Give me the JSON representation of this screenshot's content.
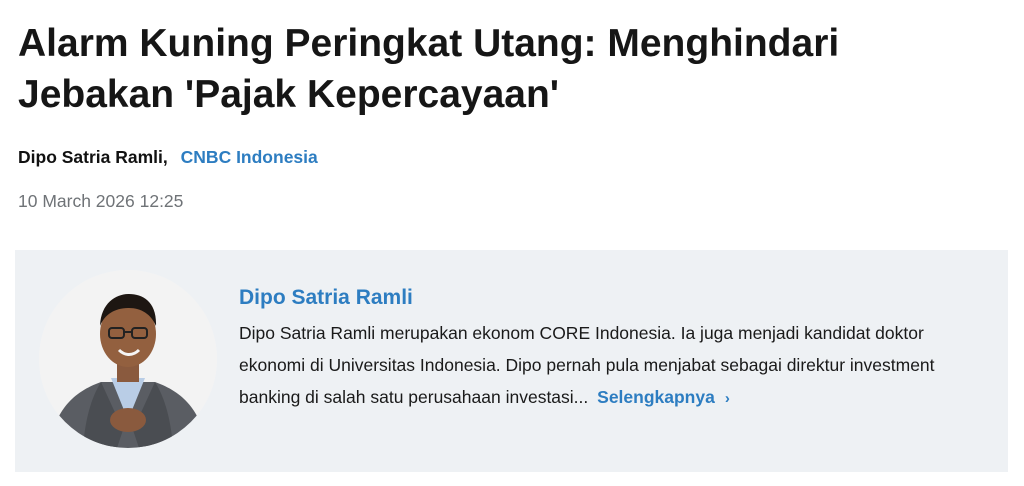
{
  "article": {
    "title_line1": "Alarm Kuning Peringkat Utang: Menghindari",
    "title_line2": "Jebakan 'Pajak Kepercayaan'",
    "author": "Dipo Satria Ramli",
    "separator": ",",
    "source": "CNBC Indonesia",
    "date": "10 March 2026 12:25"
  },
  "author_card": {
    "name": "Dipo Satria Ramli",
    "bio": "Dipo Satria Ramli merupakan ekonom CORE Indonesia. Ia juga menjadi kandidat doktor ekonomi di Universitas Indonesia. Dipo pernah pula menjabat sebagai direktur investment banking di salah satu perusahaan investasi...",
    "read_more": "Selengkapnya",
    "read_more_icon": "chevron-right-icon",
    "chevron_glyph": "›",
    "avatar_icon": "author-photo"
  },
  "colors": {
    "link": "#2d7dc1",
    "card_background": "#eef1f4",
    "date_text": "#6f7377"
  }
}
